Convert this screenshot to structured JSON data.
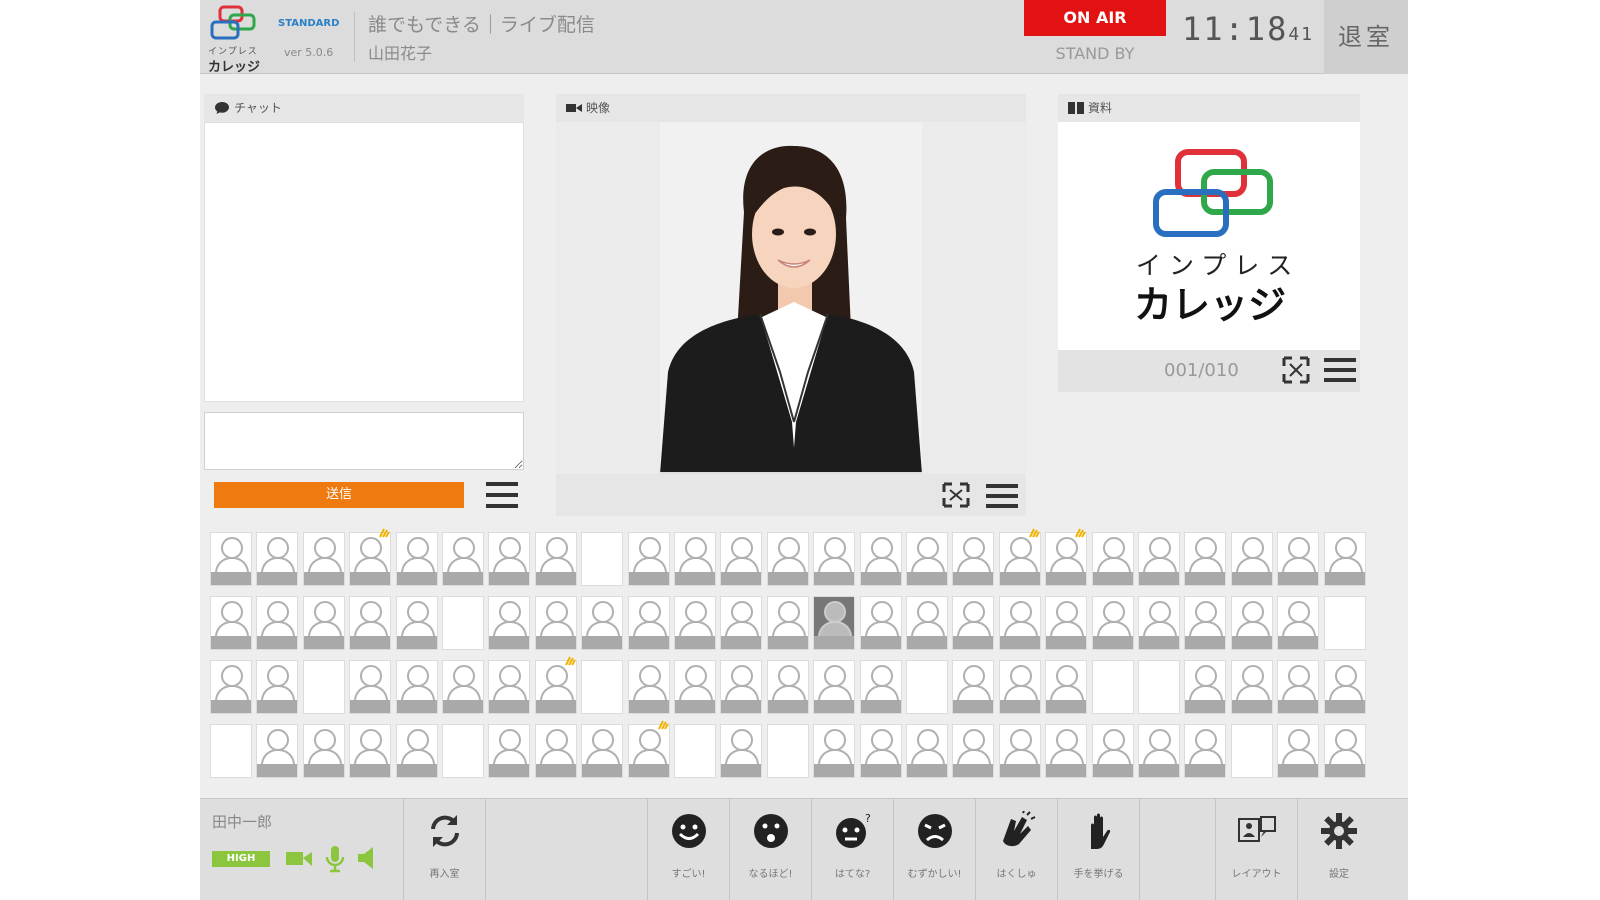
{
  "header": {
    "logo_line1": "インプレス",
    "logo_line2": "カレッジ",
    "edition": "STANDARD",
    "version": "ver 5.0.6",
    "course_title": "誰でもできる｜ライブ配信",
    "teacher_name": "山田花子",
    "onair_label": "ON AIR",
    "standby_label": "STAND BY",
    "clock_hm": "11:18",
    "clock_s": "41",
    "exit_label": "退室"
  },
  "chat": {
    "title": "チャット",
    "send_label": "送信",
    "input_value": ""
  },
  "video": {
    "title": "映像"
  },
  "document": {
    "title": "資料",
    "slide_line1": "インプレス",
    "slide_line2": "カレッジ",
    "page_counter": "001/010"
  },
  "seats": {
    "rows": [
      [
        "s",
        "s",
        "s",
        "h",
        "s",
        "s",
        "s",
        "s",
        "e",
        "s",
        "s",
        "s",
        "s",
        "s",
        "s",
        "s",
        "s",
        "h",
        "h",
        "s",
        "s",
        "s",
        "s",
        "s",
        "s"
      ],
      [
        "s",
        "s",
        "s",
        "s",
        "s",
        "e",
        "s",
        "s",
        "s",
        "s",
        "s",
        "s",
        "s",
        "x",
        "s",
        "s",
        "s",
        "s",
        "s",
        "s",
        "s",
        "s",
        "s",
        "s",
        "e"
      ],
      [
        "s",
        "s",
        "e",
        "s",
        "s",
        "s",
        "s",
        "h",
        "e",
        "s",
        "s",
        "s",
        "s",
        "s",
        "s",
        "e",
        "s",
        "s",
        "s",
        "e",
        "e",
        "s",
        "s",
        "s",
        "s"
      ],
      [
        "e",
        "s",
        "s",
        "s",
        "s",
        "e",
        "s",
        "s",
        "s",
        "h",
        "e",
        "s",
        "e",
        "s",
        "s",
        "s",
        "s",
        "s",
        "s",
        "s",
        "s",
        "s",
        "e",
        "s",
        "s"
      ]
    ]
  },
  "toolbar": {
    "my_name": "田中一郎",
    "quality_label": "HIGH",
    "reenter_label": "再入室",
    "reactions": [
      {
        "icon": "smile-icon",
        "label": "すごい!"
      },
      {
        "icon": "surprised-icon",
        "label": "なるほど!"
      },
      {
        "icon": "question-icon",
        "label": "はてな?"
      },
      {
        "icon": "troubled-icon",
        "label": "むずかしい!"
      },
      {
        "icon": "clap-icon",
        "label": "はくしゅ"
      },
      {
        "icon": "raise-hand-icon",
        "label": "手を挙げる"
      }
    ],
    "layout_label": "レイアウト",
    "settings_label": "設定"
  },
  "colors": {
    "onair_red": "#e31212",
    "send_orange": "#ee7a10",
    "quality_green": "#8cc63f",
    "logo_red": "#e0303a",
    "logo_green": "#2ea84a",
    "logo_blue": "#2a6fbf"
  }
}
